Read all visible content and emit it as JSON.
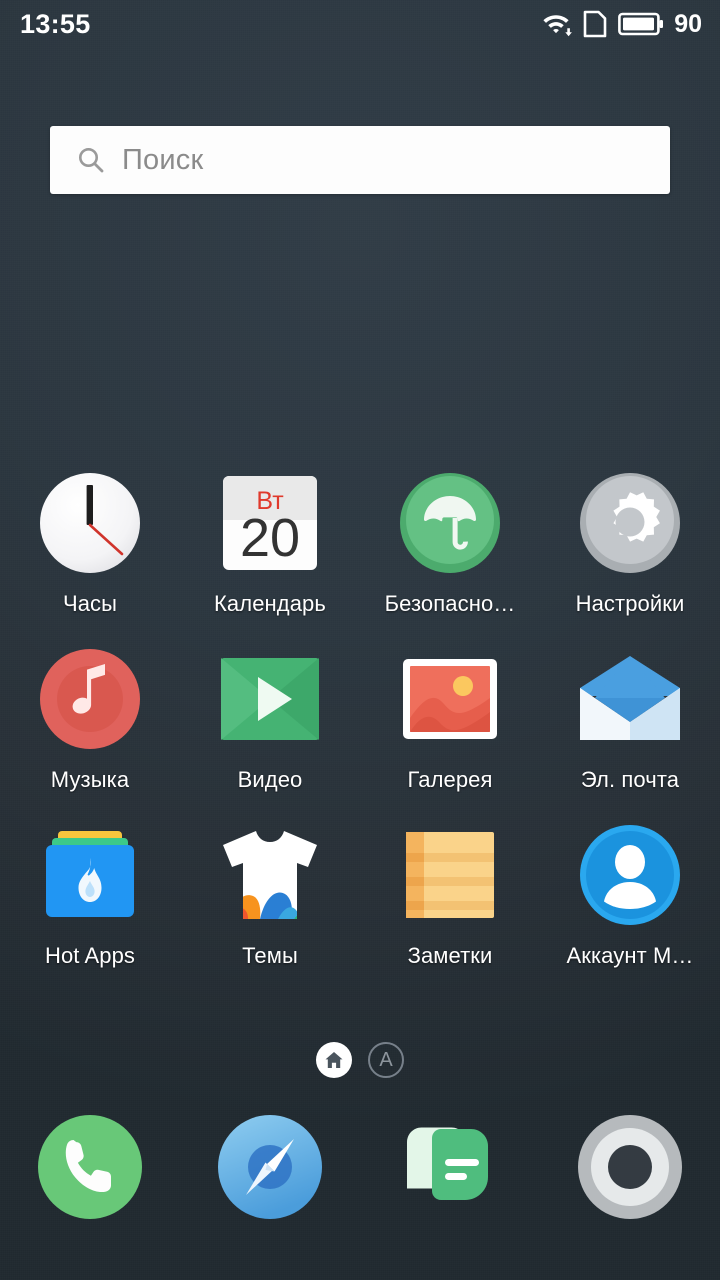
{
  "status_bar": {
    "time": "13:55",
    "battery_percent": "90",
    "icons": [
      "wifi-download-icon",
      "sim-card-icon",
      "battery-icon"
    ]
  },
  "search": {
    "placeholder": "Поиск",
    "icon": "search-icon"
  },
  "apps": [
    {
      "label": "Часы",
      "icon": "clock-icon",
      "hour_hand": "12",
      "second_hand_color": "#d0342c"
    },
    {
      "label": "Календарь",
      "icon": "calendar-icon",
      "weekday": "Вт",
      "day": "20"
    },
    {
      "label": "Безопасно…",
      "icon": "security-umbrella-icon",
      "color": "#5cbd7d"
    },
    {
      "label": "Настройки",
      "icon": "gear-icon",
      "color": "#b9bdc1"
    },
    {
      "label": "Музыка",
      "icon": "music-note-icon",
      "color": "#e0625c"
    },
    {
      "label": "Видео",
      "icon": "video-play-icon",
      "color": "#4bb878"
    },
    {
      "label": "Галерея",
      "icon": "gallery-photo-icon",
      "color": "#ec6550"
    },
    {
      "label": "Эл. почта",
      "icon": "email-envelope-icon",
      "color": "#4a9fe0"
    },
    {
      "label": "Hot Apps",
      "icon": "hot-apps-folder-flame-icon",
      "color": "#2196f3"
    },
    {
      "label": "Темы",
      "icon": "themes-tshirt-icon",
      "color": "#ffffff"
    },
    {
      "label": "Заметки",
      "icon": "notes-icon",
      "color": "#f7c877"
    },
    {
      "label": "Аккаунт M…",
      "icon": "account-person-icon",
      "color": "#1e9ee6"
    }
  ],
  "page_indicator": {
    "pages": [
      {
        "name": "home",
        "icon": "home-icon",
        "active": true
      },
      {
        "name": "apps",
        "label": "A",
        "active": false
      }
    ]
  },
  "dock": [
    {
      "name": "phone",
      "icon": "phone-handset-icon",
      "color": "#68c878"
    },
    {
      "name": "browser",
      "icon": "compass-browser-icon",
      "color": "#5aa9e0"
    },
    {
      "name": "messages",
      "icon": "message-bubble-icon",
      "color": "#4fbd7e"
    },
    {
      "name": "camera",
      "icon": "camera-lens-icon",
      "color": "#c9cdcf"
    }
  ],
  "colors": {
    "background": "#2b3740",
    "label_text": "#ffffff",
    "search_background": "#fdfdfd",
    "placeholder_text": "#8b8b8b"
  }
}
